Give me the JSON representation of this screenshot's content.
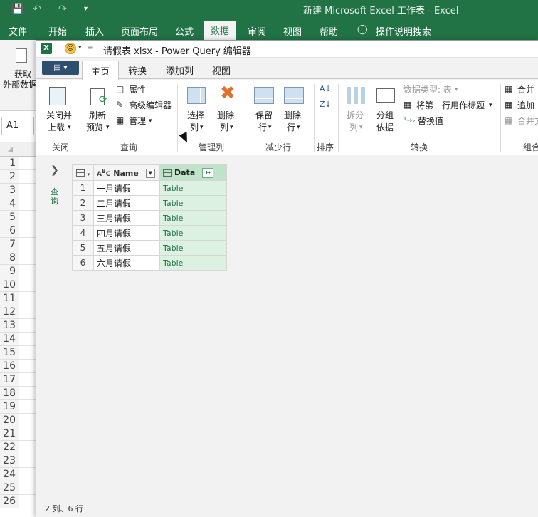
{
  "excel": {
    "title": "新建 Microsoft Excel 工作表  -  Excel",
    "tabs": [
      "文件",
      "开始",
      "插入",
      "页面布局",
      "公式",
      "数据",
      "审阅",
      "视图",
      "帮助",
      "操作说明搜索"
    ],
    "active_tab": "数据",
    "ribbon_button": "获取\n外部数据",
    "ribbon_button_line1": "获取",
    "ribbon_button_line2": "外部数据",
    "name_box": "A1",
    "row_numbers": [
      "1",
      "2",
      "3",
      "4",
      "5",
      "6",
      "7",
      "8",
      "9",
      "10",
      "11",
      "12",
      "13",
      "14",
      "15",
      "16",
      "17",
      "18",
      "19",
      "20",
      "21",
      "22",
      "23",
      "24",
      "25",
      "26"
    ]
  },
  "pq": {
    "title": "请假表 xlsx - Power Query 编辑器",
    "tabs": [
      "主页",
      "转换",
      "添加列",
      "视图"
    ],
    "active_tab": "主页",
    "ribbon": {
      "close_load_line1": "关闭并",
      "close_load_line2": "上载",
      "refresh_line1": "刷新",
      "refresh_line2": "预览",
      "properties": "属性",
      "advanced_editor": "高级编辑器",
      "manage": "管理",
      "choose_cols_line1": "选择",
      "choose_cols_line2": "列",
      "remove_cols_line1": "删除",
      "remove_cols_line2": "列",
      "keep_rows_line1": "保留",
      "keep_rows_line2": "行",
      "remove_rows_line1": "删除",
      "remove_rows_line2": "行",
      "split_line1": "拆分",
      "split_line2": "列",
      "group_line1": "分组",
      "group_line2": "依据",
      "data_type": "数据类型: 表",
      "first_row_header": "将第一行用作标题",
      "replace_values": "替换值",
      "merge": "合并",
      "append": "追加",
      "combine_files": "合并文",
      "groups": {
        "close": "关闭",
        "query": "查询",
        "manage_cols": "管理列",
        "reduce_rows": "减少行",
        "sort": "排序",
        "transform": "转换",
        "combine": "组合"
      }
    },
    "nav_label": "查询",
    "table": {
      "headers": {
        "name": "Name",
        "data": "Data"
      },
      "rows": [
        {
          "idx": "1",
          "name": "一月请假",
          "data": "Table"
        },
        {
          "idx": "2",
          "name": "二月请假",
          "data": "Table"
        },
        {
          "idx": "3",
          "name": "三月请假",
          "data": "Table"
        },
        {
          "idx": "4",
          "name": "四月请假",
          "data": "Table"
        },
        {
          "idx": "5",
          "name": "五月请假",
          "data": "Table"
        },
        {
          "idx": "6",
          "name": "六月请假",
          "data": "Table"
        }
      ]
    },
    "status": "2 列、6 行"
  },
  "colors": {
    "excel_green": "#217346",
    "table_green": "#dcf1e2",
    "pq_blue": "#2f4f6f"
  }
}
